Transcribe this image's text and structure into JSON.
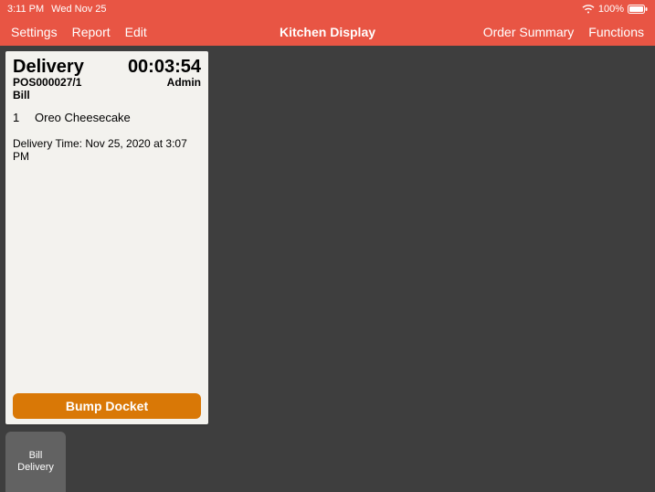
{
  "status": {
    "time": "3:11 PM",
    "date": "Wed Nov 25",
    "battery_pct": "100%"
  },
  "nav": {
    "left": {
      "settings": "Settings",
      "report": "Report",
      "edit": "Edit"
    },
    "title": "Kitchen Display",
    "right": {
      "order_summary": "Order Summary",
      "functions": "Functions"
    }
  },
  "docket": {
    "type": "Delivery",
    "timer": "00:03:54",
    "order_id": "POS000027/1",
    "user": "Admin",
    "customer": "Bill",
    "items": [
      {
        "qty": "1",
        "name": "Oreo Cheesecake"
      }
    ],
    "delivery_time_label": "Delivery Time: Nov 25, 2020 at 3:07 PM",
    "bump_label": "Bump Docket"
  },
  "station_tab": {
    "line1": "Bill",
    "line2": "Delivery"
  }
}
